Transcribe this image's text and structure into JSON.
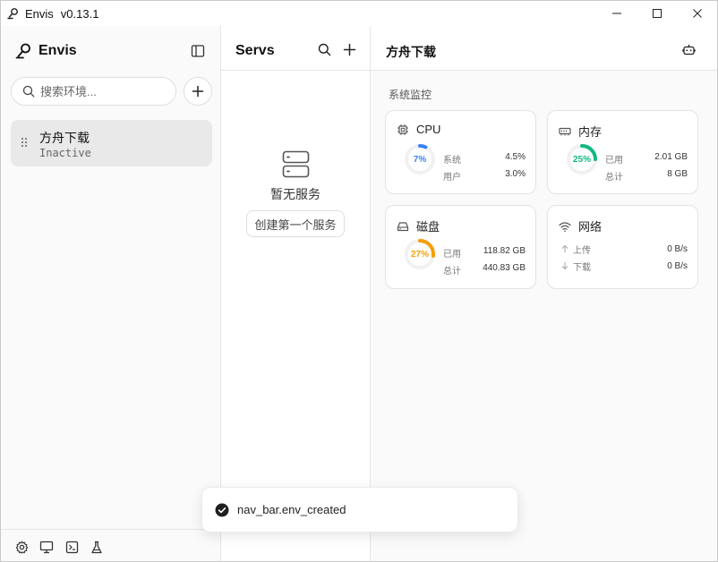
{
  "window": {
    "app_name": "Envis",
    "version": "v0.13.1"
  },
  "sidebar": {
    "brand": "Envis",
    "search_placeholder": "搜索环境...",
    "environments": [
      {
        "name": "方舟下载",
        "status": "Inactive"
      }
    ]
  },
  "servs": {
    "title": "Servs",
    "empty_text": "暂无服务",
    "create_label": "创建第一个服务"
  },
  "main": {
    "title": "方舟下载",
    "section_label": "系统监控",
    "cpu": {
      "title": "CPU",
      "percent": 7,
      "percent_label": "7%",
      "color": "#3b82f6",
      "rows": [
        {
          "label": "系统",
          "value": "4.5%"
        },
        {
          "label": "用户",
          "value": "3.0%"
        }
      ]
    },
    "memory": {
      "title": "内存",
      "percent": 25,
      "percent_label": "25%",
      "color": "#10b981",
      "rows": [
        {
          "label": "已用",
          "value": "2.01 GB"
        },
        {
          "label": "总计",
          "value": "8 GB"
        }
      ]
    },
    "disk": {
      "title": "磁盘",
      "percent": 27,
      "percent_label": "27%",
      "color": "#f59e0b",
      "rows": [
        {
          "label": "已用",
          "value": "118.82 GB"
        },
        {
          "label": "总计",
          "value": "440.83 GB"
        }
      ]
    },
    "network": {
      "title": "网络",
      "rows": [
        {
          "label": "上传",
          "value": "0 B/s"
        },
        {
          "label": "下载",
          "value": "0 B/s"
        }
      ]
    }
  },
  "toast": {
    "message": "nav_bar.env_created"
  },
  "icons": {
    "app": "envis-logo-icon",
    "footer": [
      "gear-icon",
      "monitor-icon",
      "terminal-icon",
      "flask-icon"
    ]
  }
}
